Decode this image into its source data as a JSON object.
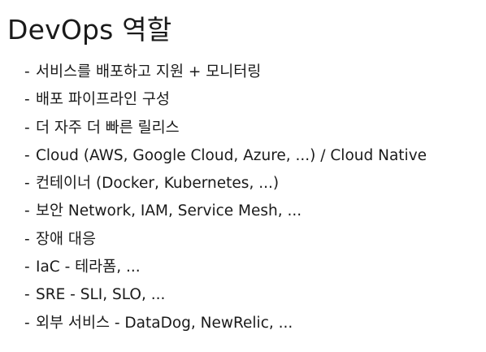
{
  "title": "DevOps 역할",
  "bullet_marker": "-",
  "bullets": [
    "서비스를 배포하고 지원 + 모니터링",
    "배포 파이프라인 구성",
    "더 자주 더 빠른 릴리스",
    "Cloud (AWS, Google Cloud, Azure, ...) / Cloud Native",
    "컨테이너 (Docker, Kubernetes, ...)",
    "보안 Network, IAM, Service Mesh, ...",
    "장애 대응",
    "IaC - 테라폼, ...",
    "SRE - SLI, SLO, ...",
    "외부 서비스 - DataDog, NewRelic, ..."
  ]
}
